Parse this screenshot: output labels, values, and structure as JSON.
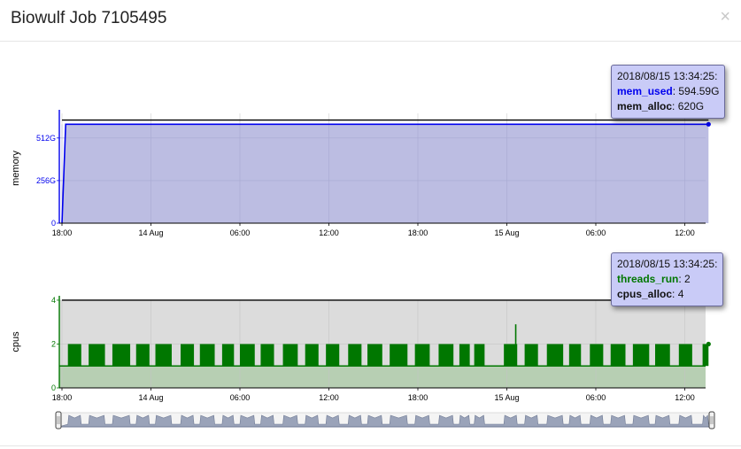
{
  "window": {
    "title": "Biowulf Job 7105495",
    "close_symbol": "×"
  },
  "colors": {
    "mem_line": "#0000ee",
    "mem_fill": "#b8b9e0",
    "cpu_line": "#007700",
    "cpu_fill": "#b7cfb3",
    "cpu_bg": "#dcdcdc",
    "alloc_line": "#000000",
    "tooltip_bg": "#c9cbf7"
  },
  "tooltips": {
    "memory": {
      "time": "2018/08/15 13:34:25:",
      "mem_used_label": "mem_used",
      "mem_used_value": ": 594.59G",
      "mem_alloc_label": "mem_alloc",
      "mem_alloc_value": ": 620G"
    },
    "cpus": {
      "time": "2018/08/15 13:34:25:",
      "threads_run_label": "threads_run",
      "threads_run_value": ": 2",
      "cpus_alloc_label": "cpus_alloc",
      "cpus_alloc_value": ": 4"
    }
  },
  "chart_data": [
    {
      "type": "area",
      "ylabel": "memory",
      "x_ticks": [
        "18:00",
        "14 Aug",
        "06:00",
        "12:00",
        "18:00",
        "15 Aug",
        "06:00",
        "12:00"
      ],
      "x_tick_hours": [
        0,
        6,
        12,
        18,
        24,
        30,
        36,
        42
      ],
      "x_range_hours": [
        0,
        43.6
      ],
      "y_ticks": [
        {
          "label": "0",
          "value": 0
        },
        {
          "label": "256G",
          "value": 256
        },
        {
          "label": "512G",
          "value": 512
        }
      ],
      "ylim": [
        0,
        660
      ],
      "grid": true,
      "series": [
        {
          "name": "mem_used",
          "points": [
            [
              0,
              0
            ],
            [
              0.25,
              594.59
            ],
            [
              43.6,
              594.59
            ]
          ]
        },
        {
          "name": "mem_alloc",
          "points": [
            [
              0,
              620
            ],
            [
              43.6,
              620
            ]
          ]
        }
      ]
    },
    {
      "type": "area",
      "ylabel": "cpus",
      "x_ticks": [
        "18:00",
        "14 Aug",
        "06:00",
        "12:00",
        "18:00",
        "15 Aug",
        "06:00",
        "12:00"
      ],
      "x_tick_hours": [
        0,
        6,
        12,
        18,
        24,
        30,
        36,
        42
      ],
      "x_range_hours": [
        0,
        43.6
      ],
      "y_ticks": [
        {
          "label": "0",
          "value": 0
        },
        {
          "label": "2",
          "value": 2
        },
        {
          "label": "4",
          "value": 4
        }
      ],
      "ylim": [
        0,
        4.2
      ],
      "grid": true,
      "baseline": 1,
      "burst_value": 2,
      "bursts": [
        [
          0.4,
          1.3
        ],
        [
          1.8,
          2.9
        ],
        [
          3.4,
          4.6
        ],
        [
          5.0,
          5.9
        ],
        [
          6.3,
          7.4
        ],
        [
          8.0,
          8.9
        ],
        [
          9.3,
          10.3
        ],
        [
          10.8,
          11.6
        ],
        [
          12.0,
          13.0
        ],
        [
          13.4,
          14.3
        ],
        [
          14.9,
          15.9
        ],
        [
          16.4,
          17.3
        ],
        [
          17.8,
          18.7
        ],
        [
          19.3,
          20.2
        ],
        [
          20.6,
          21.6
        ],
        [
          22.1,
          23.3
        ],
        [
          23.8,
          24.8
        ],
        [
          25.4,
          26.4
        ],
        [
          26.8,
          27.5
        ],
        [
          27.8,
          28.5
        ],
        [
          29.8,
          30.7
        ],
        [
          31.2,
          32.1
        ],
        [
          32.7,
          33.8
        ],
        [
          34.2,
          35.0
        ],
        [
          35.6,
          36.5
        ],
        [
          37.0,
          38.0
        ],
        [
          38.5,
          39.6
        ],
        [
          40.0,
          41.0
        ],
        [
          41.6,
          42.5
        ],
        [
          43.2,
          43.6
        ]
      ],
      "spike": {
        "x": 30.6,
        "value": 2.9
      },
      "alloc": {
        "from_hours": 0,
        "to_hours": 43.6,
        "value": 4
      },
      "last_point": {
        "x": 43.6,
        "value": 2
      }
    }
  ]
}
